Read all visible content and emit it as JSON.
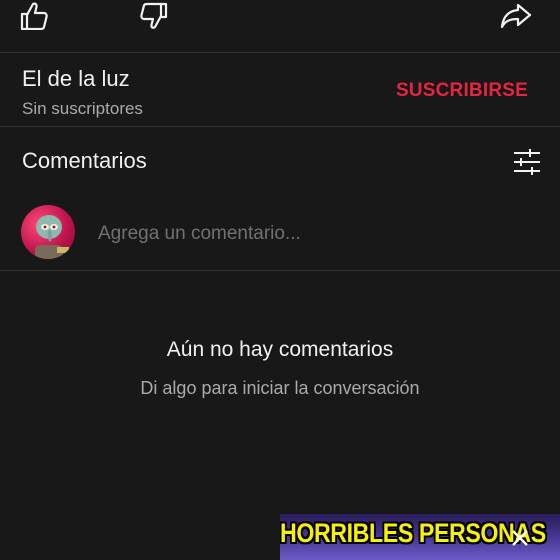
{
  "action_bar": {
    "like_icon": "thumb-up-icon",
    "dislike_icon": "thumb-down-icon",
    "share_icon": "share-icon"
  },
  "channel": {
    "name": "El de la luz",
    "subscribers": "Sin suscriptores",
    "subscribe_label": "SUSCRIBIRSE",
    "subscribe_color": "#e3263f"
  },
  "comments": {
    "title": "Comentarios",
    "filter_icon": "sliders-icon",
    "input_placeholder": "Agrega un comentario...",
    "input_value": ""
  },
  "empty_state": {
    "title": "Aún no hay comentarios",
    "subtitle": "Di algo para iniciar la conversación"
  },
  "overlay_banner": {
    "text": "HORRIBLES PERSONAS",
    "close_icon": "close-icon"
  },
  "colors": {
    "background": "#181818",
    "divider": "#333333",
    "primary_text": "#f1f1f1",
    "secondary_text": "#aaaaaa",
    "banner_text": "#f5f10a"
  }
}
